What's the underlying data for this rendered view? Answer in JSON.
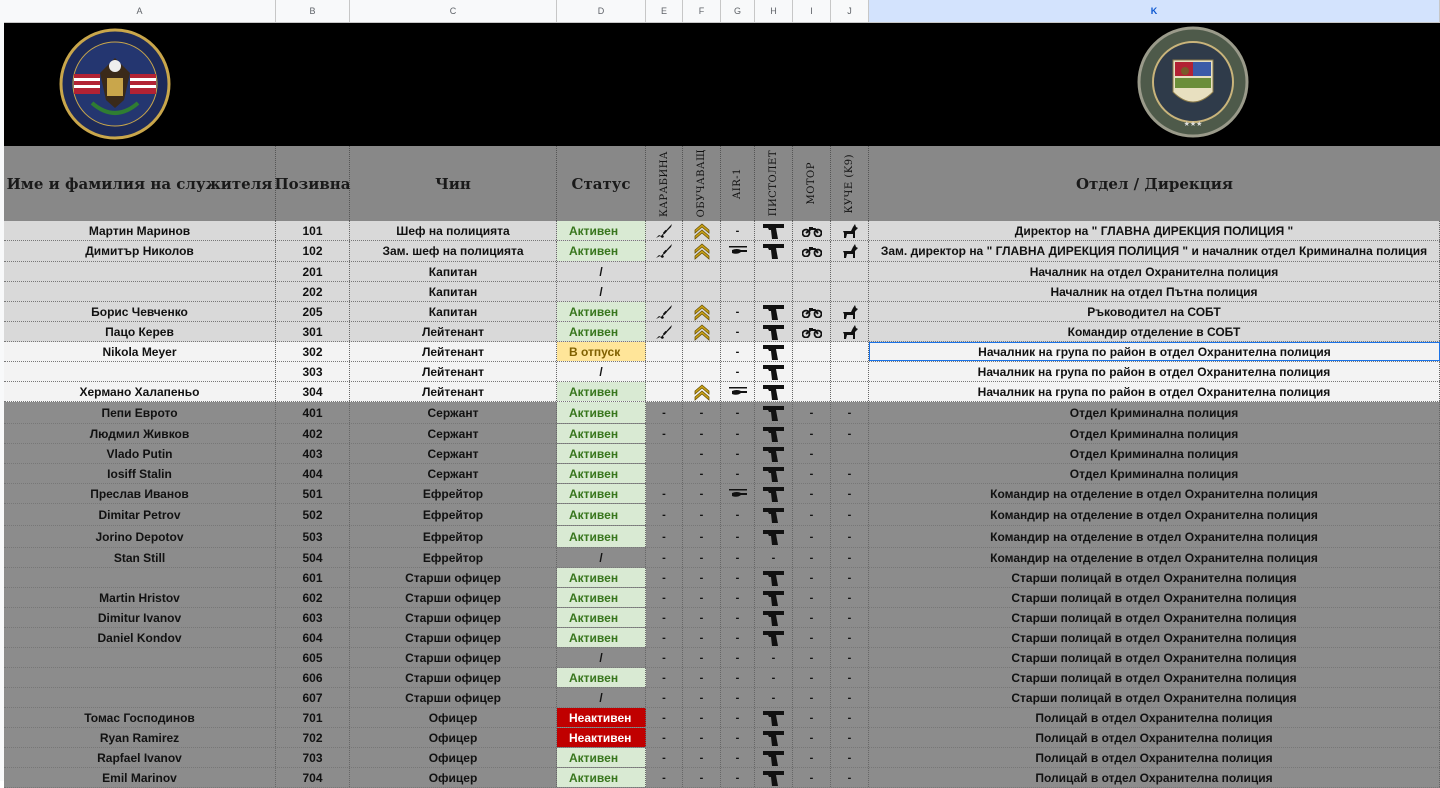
{
  "column_letters": [
    "A",
    "B",
    "C",
    "D",
    "E",
    "F",
    "G",
    "H",
    "I",
    "J",
    "K"
  ],
  "selected_column": "K",
  "banner": {
    "left_seal_text_top": "LOS SANTOS POLICE DEPARTMENT",
    "left_seal_text_bottom": "TO PROTECT AND TO SERVE",
    "right_seal_text_top": "LOS SANTOS POLICE DEPARTMENT",
    "right_seal_text_bottom": "CRIMINAL INVESTIGATION DIVISION"
  },
  "headers": {
    "name": "Име и фамилия на служителя",
    "callsign": "Позивна",
    "rank": "Чин",
    "status": "Статус",
    "carbine": "КАРАБИНА",
    "trainer": "ОБУЧАВАЩ",
    "air1": "AIR-1",
    "pistol": "ПИСТОЛЕТ",
    "motor": "МОТОР",
    "k9": "КУЧЕ (K9)",
    "department": "Отдел / Дирекция"
  },
  "colors": {
    "active_bg": "#d9ead3",
    "active_text": "#38761d",
    "vacation_bg": "#ffe599",
    "inactive_bg": "#c00000",
    "row_light": "#d9d9d9",
    "row_white": "#f3f3f3",
    "row_dark": "#8c8c8c"
  },
  "rows": [
    {
      "name": "Мартин Маринов",
      "callsign": "101",
      "rank": "Шеф на полицията",
      "status": "Активен",
      "status_type": "active",
      "carbine": "rifle",
      "trainer": "chevron",
      "air1": "-",
      "pistol": "pistol",
      "motor": "moto",
      "k9": "dog",
      "department": "Директор на \" ГЛАВНА ДИРЕКЦИЯ ПОЛИЦИЯ \"",
      "band": "light",
      "note": false
    },
    {
      "name": "Димитър Николов",
      "callsign": "102",
      "rank": "Зам. шеф на полицията",
      "status": "Активен",
      "status_type": "active",
      "carbine": "rifle",
      "trainer": "chevron",
      "air1": "heli",
      "pistol": "pistol",
      "motor": "moto",
      "k9": "dog",
      "department": "Зам. директор на \" ГЛАВНА ДИРЕКЦИЯ ПОЛИЦИЯ \" и началник отдел Криминална полиция",
      "band": "light",
      "note": true
    },
    {
      "name": "",
      "callsign": "201",
      "rank": "Капитан",
      "status": "/",
      "status_type": "none",
      "carbine": "",
      "trainer": "",
      "air1": "",
      "pistol": "",
      "motor": "",
      "k9": "",
      "department": "Началник на отдел Охранителна полиция",
      "band": "light",
      "note": false
    },
    {
      "name": "",
      "callsign": "202",
      "rank": "Капитан",
      "status": "/",
      "status_type": "none",
      "carbine": "",
      "trainer": "",
      "air1": "",
      "pistol": "",
      "motor": "",
      "k9": "",
      "department": "Началник на отдел Пътна полиция",
      "band": "light",
      "note": true
    },
    {
      "name": "Борис Чевченко",
      "callsign": "205",
      "rank": "Капитан",
      "status": "Активен",
      "status_type": "active",
      "carbine": "rifle",
      "trainer": "chevron",
      "air1": "-",
      "pistol": "pistol",
      "motor": "moto",
      "k9": "dog",
      "department": "Ръководител на СОБТ",
      "band": "light",
      "note": false
    },
    {
      "name": "Пацо Керев",
      "callsign": "301",
      "rank": "Лейтенант",
      "status": "Активен",
      "status_type": "active",
      "carbine": "rifle",
      "trainer": "chevron",
      "air1": "-",
      "pistol": "pistol",
      "motor": "moto",
      "k9": "dog",
      "department": "Командир отделение в СОБТ",
      "band": "light",
      "note": false
    },
    {
      "name": "Nikola Meyer",
      "callsign": "302",
      "rank": "Лейтенант",
      "status": "В отпуск",
      "status_type": "vacation",
      "carbine": "",
      "trainer": "",
      "air1": "-",
      "pistol": "pistol",
      "motor": "",
      "k9": "",
      "department": "Началник на група по район в отдел Охранителна полиция",
      "band": "white",
      "note": false,
      "selected": true
    },
    {
      "name": "",
      "callsign": "303",
      "rank": "Лейтенант",
      "status": "/",
      "status_type": "none",
      "carbine": "",
      "trainer": "",
      "air1": "-",
      "pistol": "pistol",
      "motor": "",
      "k9": "",
      "department": "Началник на група по район в отдел Охранителна полиция",
      "band": "white",
      "note": false
    },
    {
      "name": "Хермано Халапеньо",
      "callsign": "304",
      "rank": "Лейтенант",
      "status": "Активен",
      "status_type": "active",
      "carbine": "",
      "trainer": "chevron",
      "air1": "heli",
      "pistol": "pistol",
      "motor": "",
      "k9": "",
      "department": "Началник на група по район в отдел Охранителна полиция",
      "band": "white",
      "note": false
    },
    {
      "name": "Пепи Еврото",
      "callsign": "401",
      "rank": "Сержант",
      "status": "Активен",
      "status_type": "active",
      "carbine": "-",
      "trainer": "-",
      "air1": "-",
      "pistol": "pistol",
      "motor": "-",
      "k9": "-",
      "department": "Отдел Криминална полиция",
      "band": "dark",
      "note": true
    },
    {
      "name": "Людмил Живков",
      "callsign": "402",
      "rank": "Сержант",
      "status": "Активен",
      "status_type": "active",
      "carbine": "-",
      "trainer": "-",
      "air1": "-",
      "pistol": "pistol",
      "motor": "-",
      "k9": "-",
      "department": "Отдел Криминална полиция",
      "band": "dark",
      "note": true
    },
    {
      "name": "Vlado Putin",
      "callsign": "403",
      "rank": "Сержант",
      "status": "Активен",
      "status_type": "active",
      "carbine": "",
      "trainer": "-",
      "air1": "-",
      "pistol": "pistol",
      "motor": "-",
      "k9": "",
      "department": "Отдел Криминална полиция",
      "band": "dark",
      "note": true
    },
    {
      "name": "Iosiff Stalin",
      "callsign": "404",
      "rank": "Сержант",
      "status": "Активен",
      "status_type": "active",
      "carbine": "",
      "trainer": "-",
      "air1": "-",
      "pistol": "pistol",
      "motor": "-",
      "k9": "-",
      "department": "Отдел Криминална полиция",
      "band": "dark",
      "note": false
    },
    {
      "name": "Преслав Иванов",
      "callsign": "501",
      "rank": "Ефрейтор",
      "status": "Активен",
      "status_type": "active",
      "carbine": "-",
      "trainer": "-",
      "air1": "heli",
      "pistol": "pistol",
      "motor": "-",
      "k9": "-",
      "department": "Командир на отделение в отдел Охранителна полиция",
      "band": "dark",
      "note": false
    },
    {
      "name": "Dimitar Petrov",
      "callsign": "502",
      "rank": "Ефрейтор",
      "status": "Активен",
      "status_type": "active",
      "carbine": "-",
      "trainer": "-",
      "air1": "-",
      "pistol": "pistol",
      "motor": "-",
      "k9": "-",
      "department": "Командир на отделение в отдел Охранителна полиция",
      "band": "dark",
      "note": false
    },
    {
      "name": "Jorino Depotov",
      "callsign": "503",
      "rank": "Ефрейтор",
      "status": "Активен",
      "status_type": "active",
      "carbine": "-",
      "trainer": "-",
      "air1": "-",
      "pistol": "pistol",
      "motor": "-",
      "k9": "-",
      "department": "Командир на отделение в отдел Охранителна полиция",
      "band": "dark",
      "note": false
    },
    {
      "name": "Stan Still",
      "callsign": "504",
      "rank": "Ефрейтор",
      "status": "/",
      "status_type": "none",
      "carbine": "-",
      "trainer": "-",
      "air1": "-",
      "pistol": "-",
      "motor": "-",
      "k9": "-",
      "department": "Командир на отделение в отдел Охранителна полиция",
      "band": "dark",
      "note": false
    },
    {
      "name": "",
      "callsign": "601",
      "rank": "Старши офицер",
      "status": "Активен",
      "status_type": "active",
      "carbine": "-",
      "trainer": "-",
      "air1": "-",
      "pistol": "pistol",
      "motor": "-",
      "k9": "-",
      "department": "Старши полицай в отдел Охранителна полиция",
      "band": "dark",
      "note": false
    },
    {
      "name": "Martin Hristov",
      "callsign": "602",
      "rank": "Старши офицер",
      "status": "Активен",
      "status_type": "active",
      "carbine": "-",
      "trainer": "-",
      "air1": "-",
      "pistol": "pistol",
      "motor": "-",
      "k9": "-",
      "department": "Старши полицай в отдел Охранителна полиция",
      "band": "dark",
      "note": false
    },
    {
      "name": "Dimitur Ivanov",
      "callsign": "603",
      "rank": "Старши офицер",
      "status": "Активен",
      "status_type": "active",
      "carbine": "-",
      "trainer": "-",
      "air1": "-",
      "pistol": "pistol",
      "motor": "-",
      "k9": "-",
      "department": "Старши полицай в отдел Охранителна полиция",
      "band": "dark",
      "note": false
    },
    {
      "name": "Daniel Kondov",
      "callsign": "604",
      "rank": "Старши офицер",
      "status": "Активен",
      "status_type": "active",
      "carbine": "-",
      "trainer": "-",
      "air1": "-",
      "pistol": "pistol",
      "motor": "-",
      "k9": "-",
      "department": "Старши полицай в отдел Охранителна полиция",
      "band": "dark",
      "note": false
    },
    {
      "name": "",
      "callsign": "605",
      "rank": "Старши офицер",
      "status": "/",
      "status_type": "none",
      "carbine": "-",
      "trainer": "-",
      "air1": "-",
      "pistol": "-",
      "motor": "-",
      "k9": "-",
      "department": "Старши полицай в отдел Охранителна полиция",
      "band": "dark",
      "note": false
    },
    {
      "name": "",
      "callsign": "606",
      "rank": "Старши офицер",
      "status": "Активен",
      "status_type": "active",
      "carbine": "-",
      "trainer": "-",
      "air1": "-",
      "pistol": "-",
      "motor": "-",
      "k9": "-",
      "department": "Старши полицай в отдел Охранителна полиция",
      "band": "dark",
      "note": false
    },
    {
      "name": "",
      "callsign": "607",
      "rank": "Старши офицер",
      "status": "/",
      "status_type": "none",
      "carbine": "-",
      "trainer": "-",
      "air1": "-",
      "pistol": "-",
      "motor": "-",
      "k9": "-",
      "department": "Старши полицай в отдел Охранителна полиция",
      "band": "dark",
      "note": false
    },
    {
      "name": "Томас Господинов",
      "callsign": "701",
      "rank": "Офицер",
      "status": "Неактивен",
      "status_type": "inactive",
      "carbine": "-",
      "trainer": "-",
      "air1": "-",
      "pistol": "pistol",
      "motor": "-",
      "k9": "-",
      "department": "Полицай в отдел Охранителна полиция",
      "band": "dark",
      "note": false
    },
    {
      "name": "Ryan Ramirez",
      "callsign": "702",
      "rank": "Офицер",
      "status": "Неактивен",
      "status_type": "inactive",
      "carbine": "-",
      "trainer": "-",
      "air1": "-",
      "pistol": "pistol",
      "motor": "-",
      "k9": "-",
      "department": "Полицай в отдел Охранителна полиция",
      "band": "dark",
      "note": false
    },
    {
      "name": "Rapfael Ivanov",
      "callsign": "703",
      "rank": "Офицер",
      "status": "Активен",
      "status_type": "active",
      "carbine": "-",
      "trainer": "-",
      "air1": "-",
      "pistol": "pistol",
      "motor": "-",
      "k9": "-",
      "department": "Полицай в отдел Охранителна полиция",
      "band": "dark",
      "note": false
    },
    {
      "name": "Emil Marinov",
      "callsign": "704",
      "rank": "Офицер",
      "status": "Активен",
      "status_type": "active",
      "carbine": "-",
      "trainer": "-",
      "air1": "-",
      "pistol": "pistol",
      "motor": "-",
      "k9": "-",
      "department": "Полицай в отдел Охранителна полиция",
      "band": "dark",
      "note": false
    }
  ]
}
